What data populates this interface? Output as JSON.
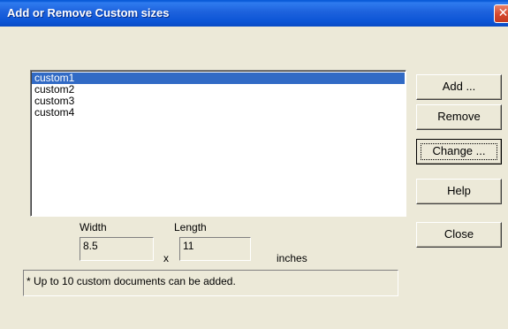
{
  "window": {
    "title": "Add or Remove Custom sizes",
    "close_glyph": "✕"
  },
  "custom_list": {
    "items": [
      "custom1",
      "custom2",
      "custom3",
      "custom4"
    ],
    "selected_index": 0
  },
  "buttons": {
    "add": "Add ...",
    "remove": "Remove",
    "change": "Change ...",
    "help": "Help",
    "close": "Close"
  },
  "dimensions": {
    "width_label": "Width",
    "length_label": "Length",
    "width_value": "8.5",
    "length_value": "11",
    "separator": "x",
    "unit": "inches"
  },
  "note": "* Up to 10 custom documents can be added.",
  "colors": {
    "selection": "#316ac5",
    "dialog_bg": "#ece9d8",
    "titlebar": "#0a5bd8"
  }
}
